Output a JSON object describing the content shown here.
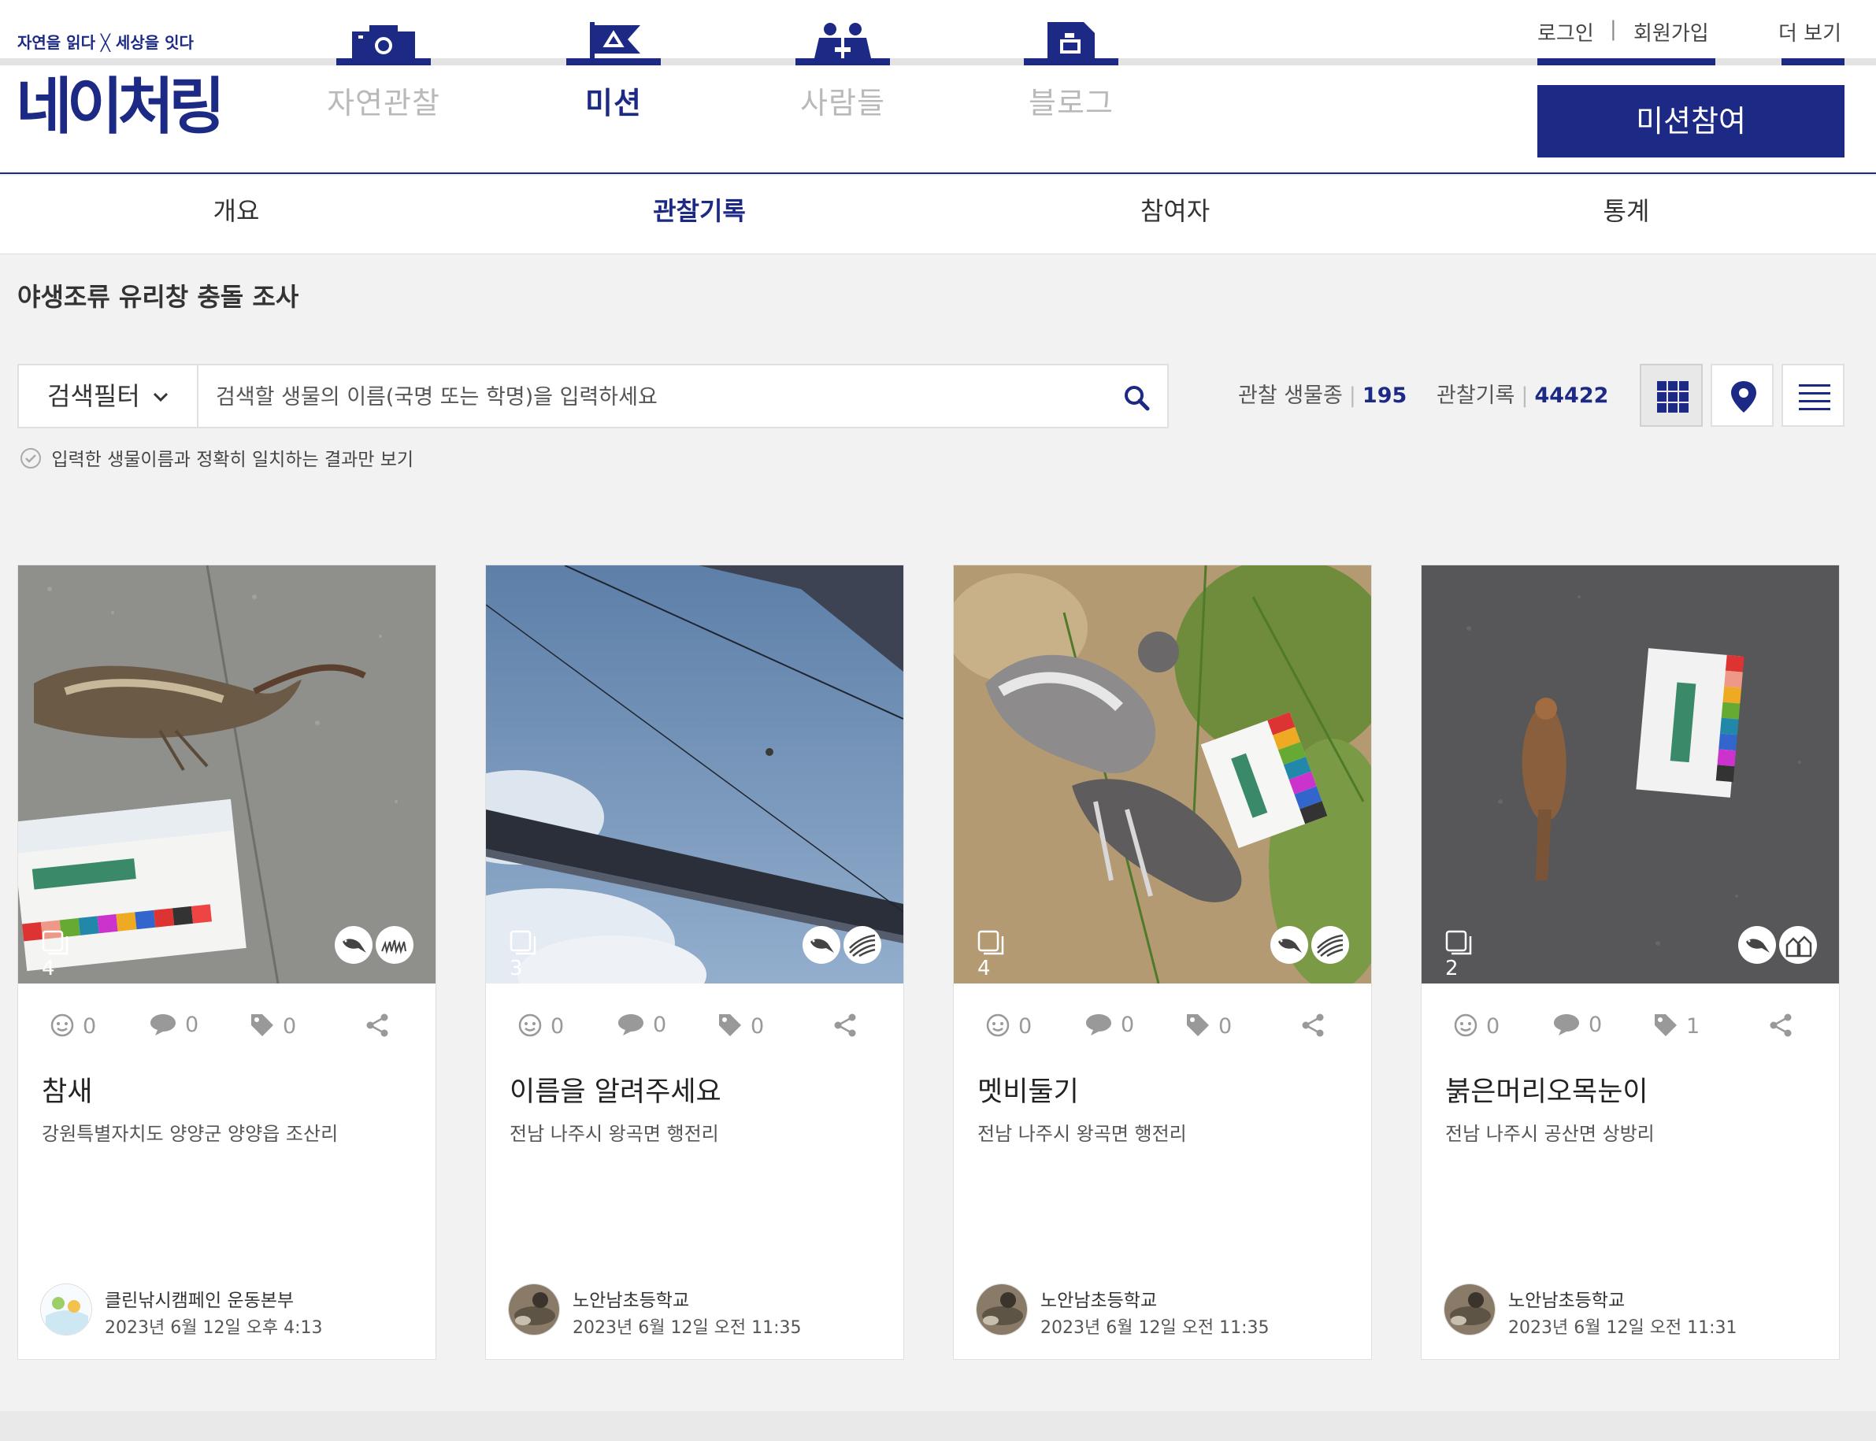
{
  "header": {
    "tagline": "자연을 읽다 ╳ 세상을 잇다",
    "logo": "네이처링",
    "nav": [
      {
        "label": "자연관찰",
        "icon": "camera-icon"
      },
      {
        "label": "미션",
        "icon": "flag-icon"
      },
      {
        "label": "사람들",
        "icon": "people-icon"
      },
      {
        "label": "블로그",
        "icon": "note-icon"
      }
    ],
    "login": "로그인",
    "divider": "|",
    "signup": "회원가입",
    "more": "더 보기",
    "cta": "미션참여"
  },
  "subnav": [
    "개요",
    "관찰기록",
    "참여자",
    "통계"
  ],
  "page_title": "야생조류 유리창 충돌 조사",
  "search": {
    "filter_label": "검색필터",
    "placeholder": "검색할 생물의 이름(국명 또는 학명)을 입력하세요",
    "exact_match_label": "입력한 생물이름과 정확히 일치하는 결과만 보기"
  },
  "stats": {
    "species_label": "관찰 생물종",
    "species_count": "195",
    "records_label": "관찰기록",
    "records_count": "44422"
  },
  "colors": {
    "navy": "#1d2a85"
  },
  "cards": [
    {
      "name": "참새",
      "location": "강원특별자치도 양양군 양양읍 조산리",
      "photos": "4",
      "likes": "0",
      "comments": "0",
      "tags": "0",
      "author": "클린낚시캠페인 운동본부",
      "date": "2023년 6월 12일 오후 4:13",
      "badge_icon": "grassland-icon"
    },
    {
      "name": "이름을 알려주세요",
      "location": "전남 나주시 왕곡면 행전리",
      "photos": "3",
      "likes": "0",
      "comments": "0",
      "tags": "0",
      "author": "노안남초등학교",
      "date": "2023년 6월 12일 오전 11:35",
      "badge_icon": "field-icon"
    },
    {
      "name": "멧비둘기",
      "location": "전남 나주시 왕곡면 행전리",
      "photos": "4",
      "likes": "0",
      "comments": "0",
      "tags": "0",
      "author": "노안남초등학교",
      "date": "2023년 6월 12일 오전 11:35",
      "badge_icon": "field-icon"
    },
    {
      "name": "붉은머리오목눈이",
      "location": "전남 나주시 공산면 상방리",
      "photos": "2",
      "likes": "0",
      "comments": "0",
      "tags": "1",
      "author": "노안남초등학교",
      "date": "2023년 6월 12일 오전 11:31",
      "badge_icon": "house-icon"
    }
  ]
}
